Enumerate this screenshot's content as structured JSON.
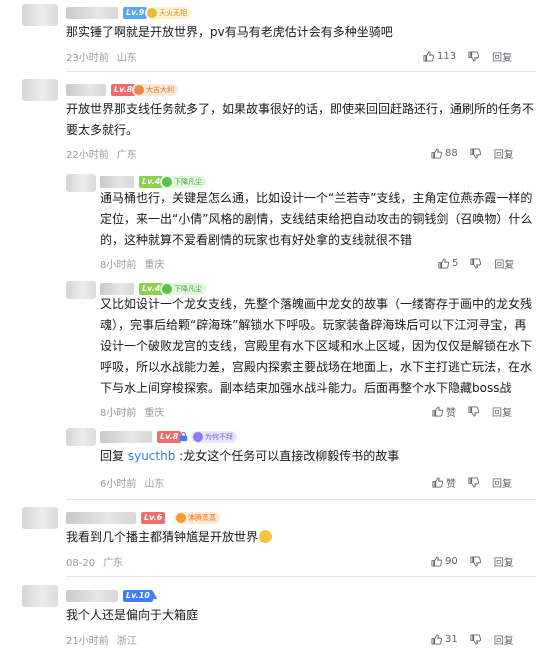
{
  "comments": [
    {
      "level": "Lv.9",
      "badge": "天火无相",
      "text": "那实锤了啊就是开放世界，pv有马有老虎估计会有多种坐骑吧",
      "time": "23小时前",
      "location": "山东",
      "likes": "113",
      "like_label": "",
      "dislike_label": "",
      "reply_label": "回复"
    },
    {
      "level": "Lv.8",
      "badge": "大吉大利",
      "text": "开放世界那支线任务就多了，如果故事很好的话，即使来回回赶路还行，通刷所的任务不要太多就行。",
      "time": "22小时前",
      "location": "广东",
      "likes": "88",
      "reply_label": "回复"
    },
    {
      "level": "Lv.4",
      "badge": "下降凡尘",
      "text": "通马桶也行，关键是怎么通，比如设计一个“兰若寺”支线，主角定位燕赤霞一样的定位，来一出“小倩”风格的剧情，支线结束给把自动攻击的铜钱剑（召唤物）什么的，这种就算不爱看剧情的玩家也有好处拿的支线就很不错",
      "time": "8小时前",
      "location": "重庆",
      "likes": "5",
      "reply_label": "回复"
    },
    {
      "level": "Lv.4",
      "badge": "下降凡尘",
      "text": "又比如设计一个龙女支线，先整个落魄画中龙女的故事（一缕寄存于画中的龙女残魂），完事后给颗“辟海珠”解锁水下呼吸。玩家装备辟海珠后可以下江河寻宝，再设计一个破败龙宫的支线，宫殿里有水下区域和水上区域，因为仅仅是解锁在水下呼吸，所以水战能力差，宫殿内探索主要战场在地面上，水下主打逃亡玩法，在水下与水上间穿梭探索。副本结束加强水战斗能力。后面再整个水下隐藏boss战",
      "time": "8小时前",
      "location": "重庆",
      "like_label": "赞",
      "reply_label": "回复"
    },
    {
      "level": "Lv.8",
      "badge": "为何不拜",
      "reply_prefix": "回复",
      "mention": "syucthb",
      "text": ":龙女这个任务可以直接改柳毅传书的故事",
      "time": "6小时前",
      "location": "山东",
      "like_label": "赞",
      "reply_label": "回复"
    },
    {
      "level": "Lv.6",
      "badge": "沸腾蒸蒸",
      "text": "我看到几个播主都猜钟馗是开放世界",
      "time": "08-20",
      "location": "广东",
      "likes": "90",
      "reply_label": "回复"
    },
    {
      "level": "Lv.10",
      "text": "我个人还是偏向于大箱庭",
      "time": "21小时前",
      "location": "浙江",
      "likes": "31",
      "reply_label": "回复"
    }
  ],
  "colors": {
    "text": "#18191c",
    "meta": "#9499a0",
    "mention": "#2f7fd6",
    "divider": "#e3e5e7"
  }
}
